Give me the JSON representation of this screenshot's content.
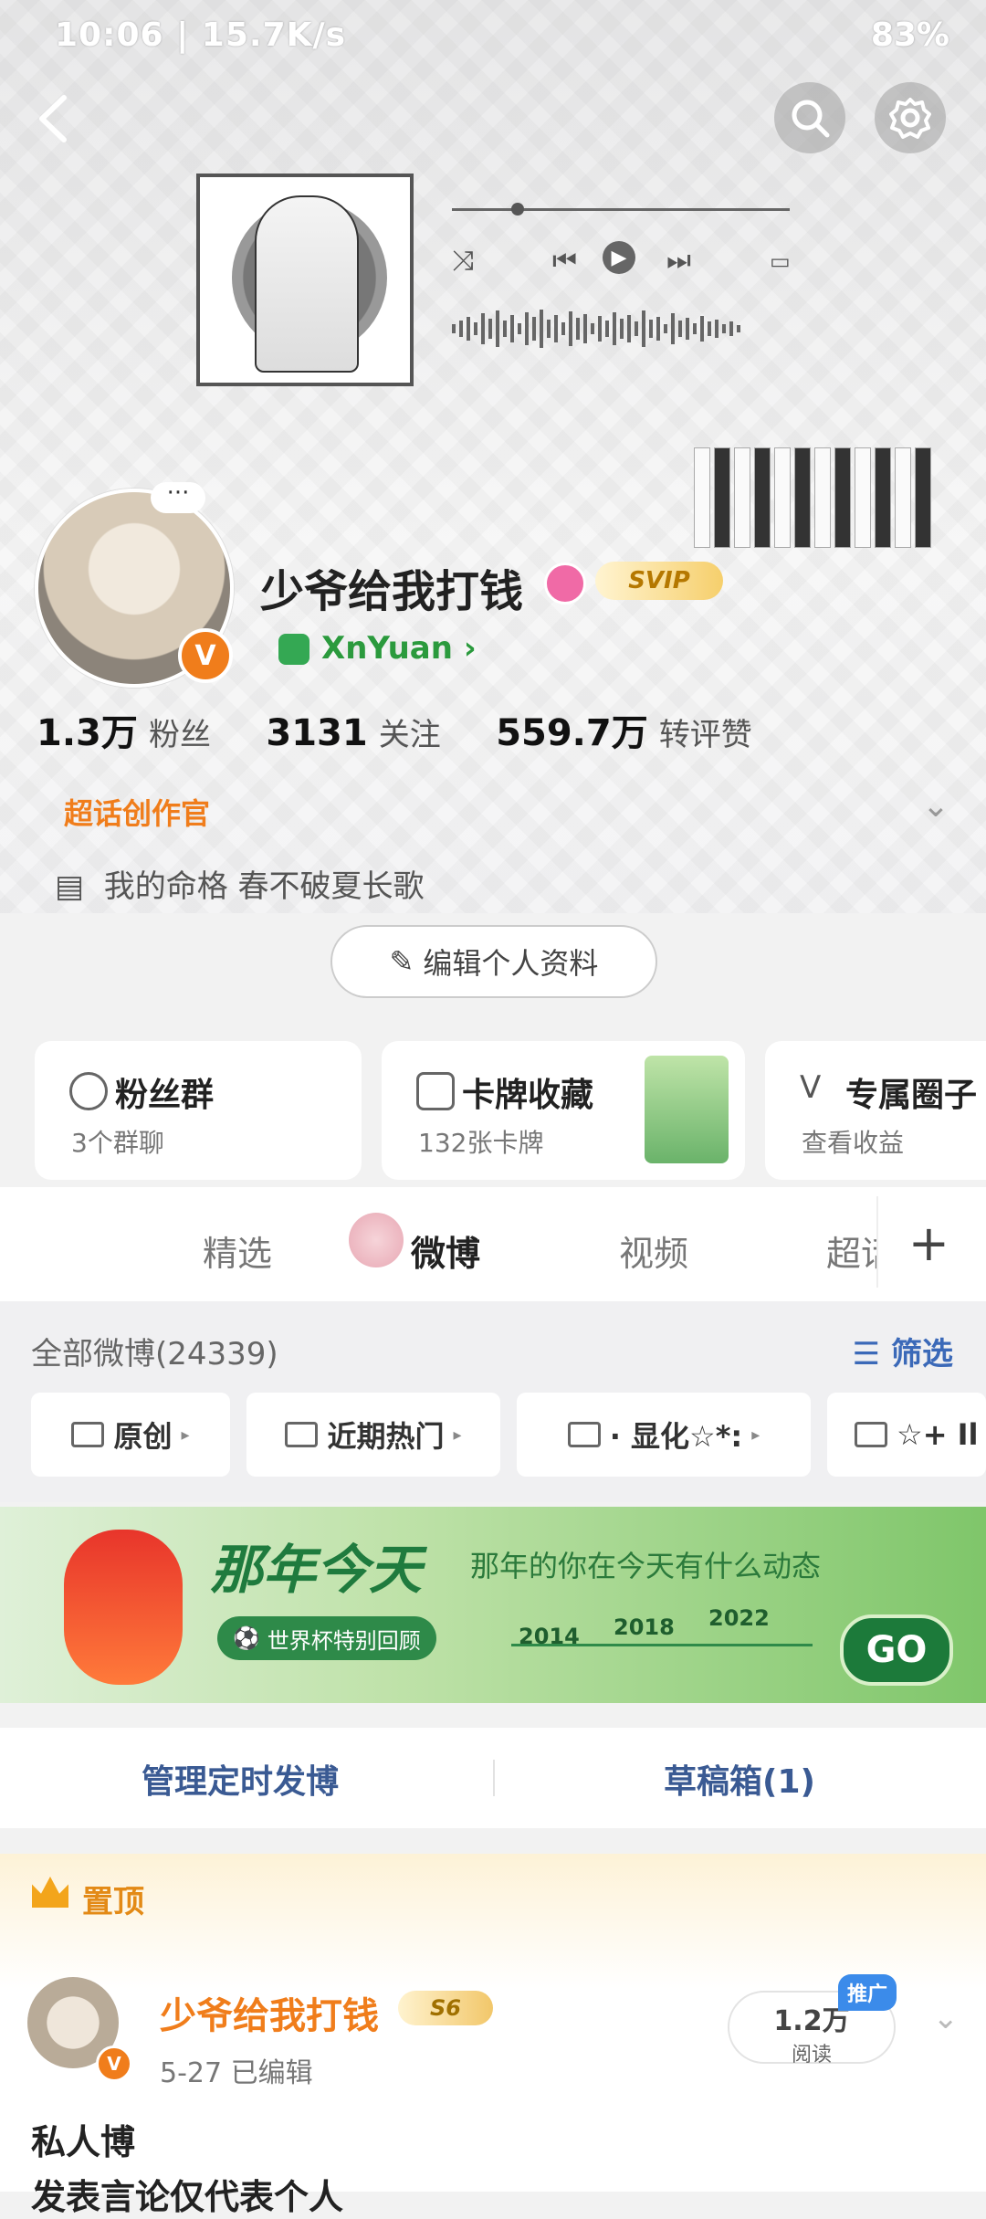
{
  "status_bar": {
    "left": "10:06 | 15.7K/s",
    "right": "83%"
  },
  "header": {
    "back_icon": "back-arrow-icon",
    "search_icon": "search-icon",
    "settings_icon": "gear-icon"
  },
  "profile": {
    "avatar_more": "···",
    "username": "少爷给我打钱",
    "vip_badge": "SVIP",
    "nickname": "XnYuan",
    "stats": [
      {
        "value": "1.3万",
        "label": "粉丝"
      },
      {
        "value": "3131",
        "label": "关注"
      },
      {
        "value": "559.7万",
        "label": "转评赞"
      }
    ],
    "super_tag": "超话创作官",
    "bio": "我的命格 春不破夏长歌",
    "edit_button": "编辑个人资料"
  },
  "cards": [
    {
      "title": "粉丝群",
      "subtitle": "3个群聊"
    },
    {
      "title": "卡牌收藏",
      "subtitle": "132张卡牌"
    },
    {
      "title": "专属圈子",
      "subtitle": "查看收益"
    }
  ],
  "tabs": {
    "items": [
      "精选",
      "微博",
      "视频",
      "超话"
    ],
    "active_index": 1,
    "plus": "+"
  },
  "feed": {
    "all_count": "全部微博(24339)",
    "filter": "筛选",
    "chips": [
      "原创",
      "近期热门",
      "· 显化☆*:",
      "☆+ Il"
    ]
  },
  "banner": {
    "title": "那年今天",
    "subtitle": "那年的你在今天有什么动态",
    "pill": "世界杯特别回顾",
    "years": [
      "2014",
      "2018",
      "2022"
    ],
    "go": "GO"
  },
  "actions": {
    "left": "管理定时发博",
    "right": "草稿箱(1)"
  },
  "pinned": {
    "label": "置顶",
    "author": "少爷给我打钱",
    "level_badge": "S6",
    "meta": "5-27  已编辑",
    "reads_value": "1.2万",
    "reads_label": "阅读",
    "promo": "推广",
    "text_line1": "私人博",
    "text_line2": "发表言论仅代表个人"
  }
}
